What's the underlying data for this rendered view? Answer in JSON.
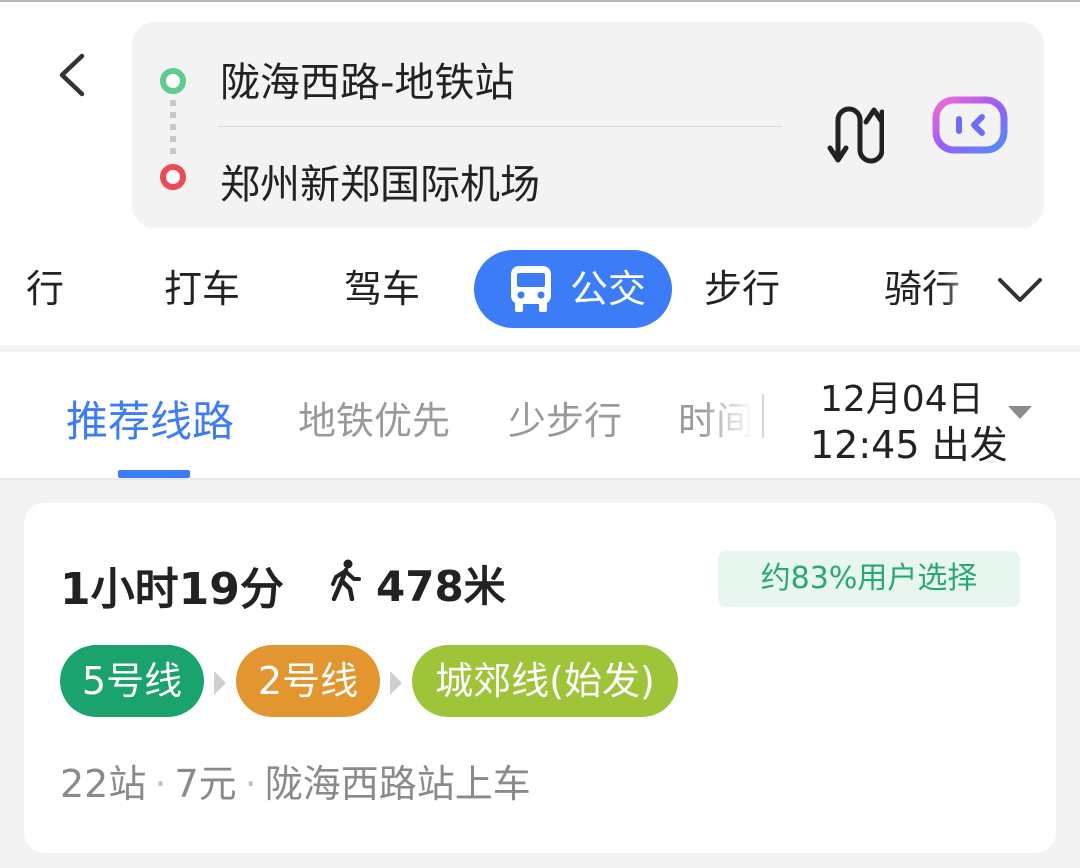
{
  "route": {
    "from": "陇海西路-地铁站",
    "to": "郑州新郑国际机场"
  },
  "modes": {
    "items": [
      "行",
      "打车",
      "驾车",
      "公交",
      "步行",
      "骑行"
    ],
    "active": "公交"
  },
  "tabs": {
    "items": [
      "推荐线路",
      "地铁优先",
      "少步行",
      "时间"
    ],
    "active": "推荐线路"
  },
  "departure": {
    "date": "12月04日",
    "time": "12:45 出发"
  },
  "result": {
    "duration": "1小时19分",
    "walk_distance": "478米",
    "popularity_badge": "约83%用户选择",
    "lines": [
      {
        "label": "5号线",
        "color": "#1aa36c"
      },
      {
        "label": "2号线",
        "color": "#e3962f"
      },
      {
        "label": "城郊线(始发)",
        "color": "#9ec43a"
      }
    ],
    "stops": "22站",
    "fare": "7元",
    "board_at": "陇海西路站上车"
  },
  "colors": {
    "accent": "#3d7cf7",
    "start_dot": "#5fcb8f",
    "end_dot": "#ec4b55"
  },
  "icons": [
    "back-icon",
    "swap-icon",
    "voice-assistant-icon",
    "bus-icon",
    "chevron-down-icon",
    "walking-icon",
    "dropdown-caret-icon"
  ]
}
